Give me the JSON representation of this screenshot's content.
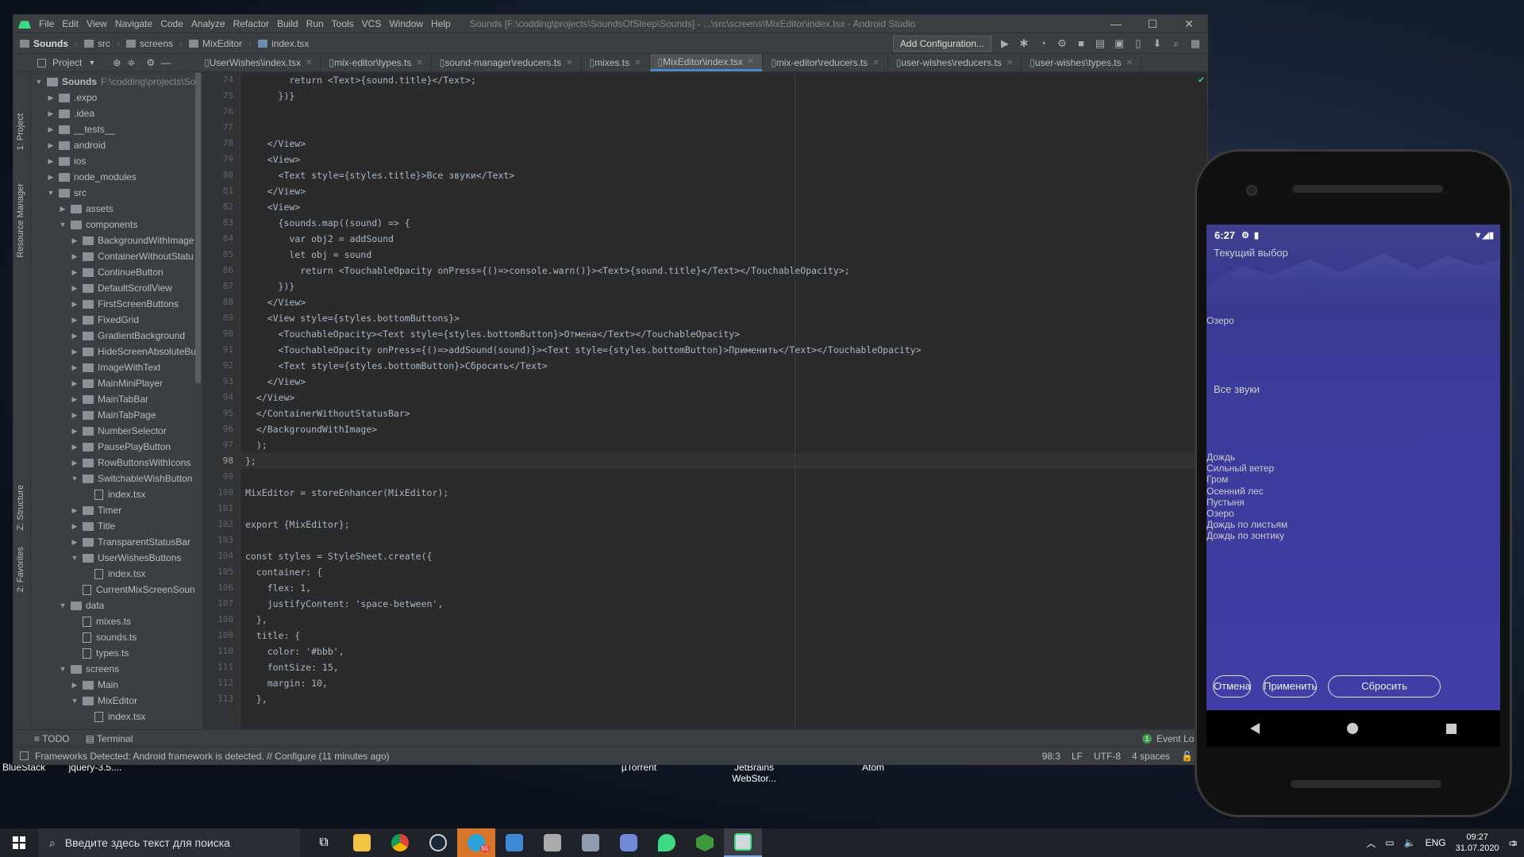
{
  "desktop": {
    "labels": [
      "BlueStack",
      "jquery-3.5....",
      "µTorrent",
      "JetBrains WebStor...",
      "Atom"
    ]
  },
  "ide": {
    "title": "Sounds [F:\\codding\\projects\\SoundsOfSleep\\Sounds] - ...\\src\\screens\\MixEditor\\index.tsx - Android Studio",
    "menu": [
      "File",
      "Edit",
      "View",
      "Navigate",
      "Code",
      "Analyze",
      "Refactor",
      "Build",
      "Run",
      "Tools",
      "VCS",
      "Window",
      "Help"
    ],
    "breadcrumbs": [
      "Sounds",
      "src",
      "screens",
      "MixEditor",
      "index.tsx"
    ],
    "add_config": "Add Configuration...",
    "project_label": "Project",
    "tabs": [
      "UserWishes\\index.tsx",
      "mix-editor\\types.ts",
      "sound-manager\\reducers.ts",
      "mixes.ts",
      "MixEditor\\index.tsx",
      "mix-editor\\reducers.ts",
      "user-wishes\\reducers.ts",
      "user-wishes\\types.ts"
    ],
    "active_tab": 4,
    "left_strip": [
      "1: Project",
      "Resource Manager",
      "Z: Structure",
      "2: Favorites"
    ],
    "tree": [
      {
        "label": "Sounds",
        "depth": 0,
        "type": "folder",
        "open": true,
        "extra": "F:\\codding\\projects\\Sou"
      },
      {
        "label": ".expo",
        "depth": 1,
        "type": "folder"
      },
      {
        "label": ".idea",
        "depth": 1,
        "type": "folder"
      },
      {
        "label": "__tests__",
        "depth": 1,
        "type": "folder"
      },
      {
        "label": "android",
        "depth": 1,
        "type": "folder"
      },
      {
        "label": "ios",
        "depth": 1,
        "type": "folder"
      },
      {
        "label": "node_modules",
        "depth": 1,
        "type": "folder"
      },
      {
        "label": "src",
        "depth": 1,
        "type": "folder",
        "open": true
      },
      {
        "label": "assets",
        "depth": 2,
        "type": "folder"
      },
      {
        "label": "components",
        "depth": 2,
        "type": "folder",
        "open": true
      },
      {
        "label": "BackgroundWithImage",
        "depth": 3,
        "type": "folder"
      },
      {
        "label": "ContainerWithoutStatu",
        "depth": 3,
        "type": "folder"
      },
      {
        "label": "ContinueButton",
        "depth": 3,
        "type": "folder"
      },
      {
        "label": "DefaultScrollView",
        "depth": 3,
        "type": "folder"
      },
      {
        "label": "FirstScreenButtons",
        "depth": 3,
        "type": "folder"
      },
      {
        "label": "FixedGrid",
        "depth": 3,
        "type": "folder"
      },
      {
        "label": "GradientBackground",
        "depth": 3,
        "type": "folder"
      },
      {
        "label": "HideScreenAbsoluteBu",
        "depth": 3,
        "type": "folder"
      },
      {
        "label": "ImageWithText",
        "depth": 3,
        "type": "folder"
      },
      {
        "label": "MainMiniPlayer",
        "depth": 3,
        "type": "folder"
      },
      {
        "label": "MainTabBar",
        "depth": 3,
        "type": "folder"
      },
      {
        "label": "MainTabPage",
        "depth": 3,
        "type": "folder"
      },
      {
        "label": "NumberSelector",
        "depth": 3,
        "type": "folder"
      },
      {
        "label": "PausePlayButton",
        "depth": 3,
        "type": "folder"
      },
      {
        "label": "RowButtonsWithIcons",
        "depth": 3,
        "type": "folder"
      },
      {
        "label": "SwitchableWishButton",
        "depth": 3,
        "type": "folder",
        "open": true
      },
      {
        "label": "index.tsx",
        "depth": 4,
        "type": "file"
      },
      {
        "label": "Timer",
        "depth": 3,
        "type": "folder"
      },
      {
        "label": "Title",
        "depth": 3,
        "type": "folder"
      },
      {
        "label": "TransparentStatusBar",
        "depth": 3,
        "type": "folder"
      },
      {
        "label": "UserWishesButtons",
        "depth": 3,
        "type": "folder",
        "open": true
      },
      {
        "label": "index.tsx",
        "depth": 4,
        "type": "file"
      },
      {
        "label": "CurrentMixScreenSoun",
        "depth": 3,
        "type": "file"
      },
      {
        "label": "data",
        "depth": 2,
        "type": "folder",
        "open": true
      },
      {
        "label": "mixes.ts",
        "depth": 3,
        "type": "file"
      },
      {
        "label": "sounds.ts",
        "depth": 3,
        "type": "file"
      },
      {
        "label": "types.ts",
        "depth": 3,
        "type": "file"
      },
      {
        "label": "screens",
        "depth": 2,
        "type": "folder",
        "open": true
      },
      {
        "label": "Main",
        "depth": 3,
        "type": "folder"
      },
      {
        "label": "MixEditor",
        "depth": 3,
        "type": "folder",
        "open": true
      },
      {
        "label": "index.tsx",
        "depth": 4,
        "type": "file"
      }
    ],
    "line_numbers": [
      74,
      75,
      76,
      77,
      78,
      79,
      80,
      81,
      82,
      83,
      84,
      85,
      86,
      87,
      88,
      89,
      90,
      91,
      92,
      93,
      94,
      95,
      96,
      97,
      98,
      99,
      100,
      101,
      102,
      103,
      104,
      105,
      106,
      107,
      108,
      109,
      110,
      111,
      112,
      113
    ],
    "current_line": 98,
    "code": [
      "        return <Text>{sound.title}</Text>;",
      "      })}",
      "",
      "",
      "    </View>",
      "    <View>",
      "      <Text style={styles.title}>Все звуки</Text>",
      "    </View>",
      "    <View>",
      "      {sounds.map((sound) => {",
      "        var obj2 = addSound",
      "        let obj = sound",
      "          return <TouchableOpacity onPress={()=>console.warn()}><Text>{sound.title}</Text></TouchableOpacity>;",
      "      })}",
      "    </View>",
      "    <View style={styles.bottomButtons}>",
      "      <TouchableOpacity><Text style={styles.bottomButton}>Отмена</Text></TouchableOpacity>",
      "      <TouchableOpacity onPress={()=>addSound(sound)}><Text style={styles.bottomButton}>Применить</Text></TouchableOpacity>",
      "      <Text style={styles.bottomButton}>Сбросить</Text>",
      "    </View>",
      "  </View>",
      "  </ContainerWithoutStatusBar>",
      "  </BackgroundWithImage>",
      "  );",
      "};",
      "",
      "MixEditor = storeEnhancer(MixEditor);",
      "",
      "export {MixEditor};",
      "",
      "const styles = StyleSheet.create({",
      "  container: {",
      "    flex: 1,",
      "    justifyContent: 'space-between',",
      "  },",
      "  title: {",
      "    color: '#bbb',",
      "    fontSize: 15,",
      "    margin: 10,",
      "  },"
    ],
    "bottom_tabs": [
      "TODO",
      "Terminal"
    ],
    "event_log": "Event Log",
    "event_count": "1",
    "status_msg": "Frameworks Detected: Android framework is detected. // Configure (11 minutes ago)",
    "status_right": [
      "98:3",
      "LF",
      "UTF-8",
      "4 spaces"
    ]
  },
  "phone": {
    "time": "6:27",
    "current_choice_label": "Текущий выбор",
    "current_item": "Озеро",
    "all_sounds_label": "Все звуки",
    "sounds": [
      "Дождь",
      "Сильный ветер",
      "Гром",
      "Осенний лес",
      "Пустыня",
      "Озеро",
      "Дождь по листьям",
      "Дождь по зонтику"
    ],
    "btn_cancel": "Отмена",
    "btn_apply": "Применить",
    "btn_reset": "Сбросить"
  },
  "taskbar": {
    "search_placeholder": "Введите здесь текст для поиска",
    "lang": "ENG",
    "time": "09:27",
    "date": "31.07.2020",
    "notif_count": "3",
    "telegram_badge": "65"
  }
}
